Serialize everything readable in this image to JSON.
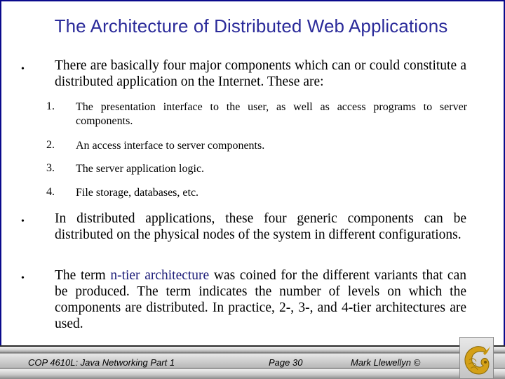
{
  "slide": {
    "title": "The Architecture of Distributed Web Applications",
    "bullets": [
      {
        "marker": "•",
        "text": "There are basically four major components which can or could constitute a distributed application on the Internet.  These are:",
        "items": [
          {
            "number": "1.",
            "text": "The presentation interface to the user, as well as access programs to server components."
          },
          {
            "number": "2.",
            "text": "An access interface to server components."
          },
          {
            "number": "3.",
            "text": "The server application logic."
          },
          {
            "number": "4.",
            "text": "File storage, databases, etc."
          }
        ]
      },
      {
        "marker": "•",
        "text": "In distributed applications, these four generic components can be distributed on the physical nodes of the system in different configurations."
      },
      {
        "marker": "•",
        "text_before": "The term ",
        "highlight": "n-tier architecture",
        "text_after": " was coined for the different variants that can be produced.  The term indicates the number of levels on which the components are distributed.  In practice, 2-, 3-, and 4-tier architectures are used."
      }
    ]
  },
  "footer": {
    "course": "COP 4610L: Java Networking Part 1",
    "page": "Page 30",
    "author": "Mark Llewellyn ©",
    "logo_icon": "pegasus-logo-icon"
  },
  "colors": {
    "frame": "#0a0a8c",
    "title": "#2b2b9a",
    "highlight": "#1c1c78",
    "logo_gold": "#d4a017"
  }
}
